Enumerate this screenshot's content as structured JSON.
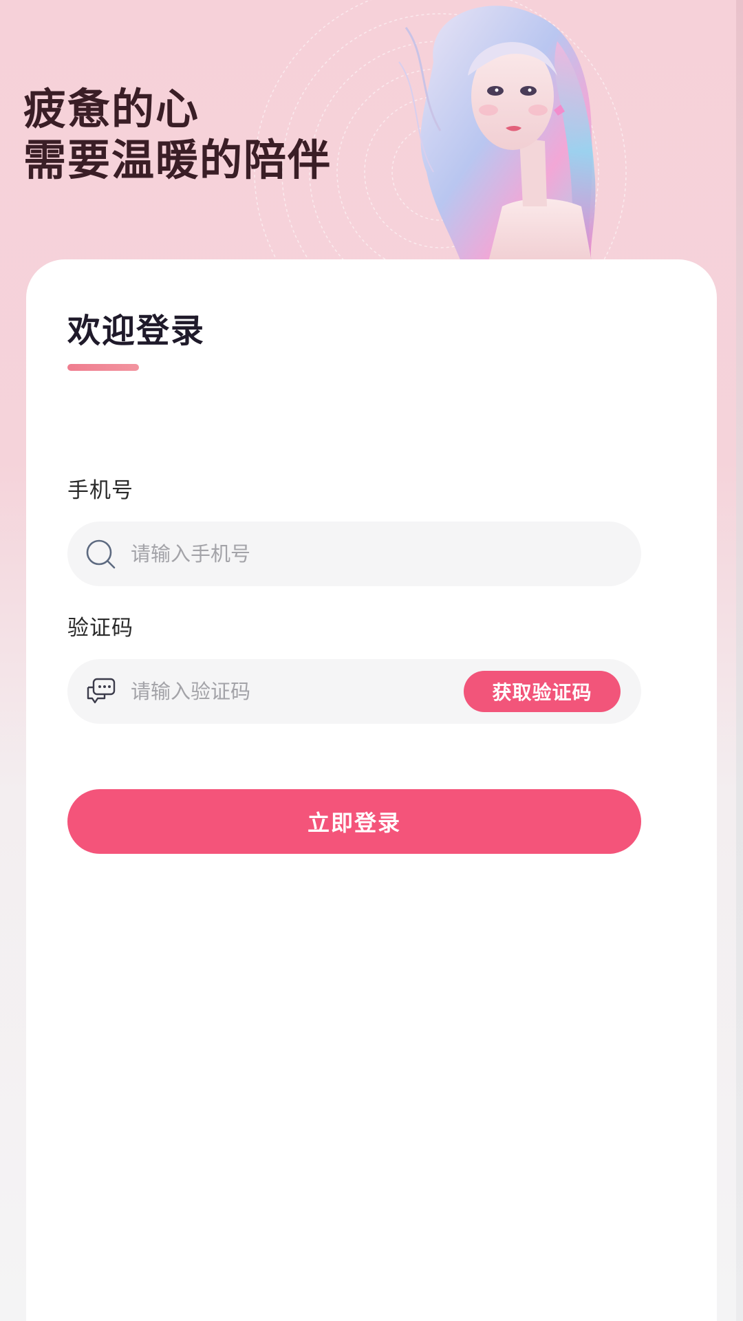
{
  "hero": {
    "line1": "疲惫的心",
    "line2": "需要温暖的陪伴"
  },
  "login_card": {
    "title": "欢迎登录",
    "phone": {
      "label": "手机号",
      "placeholder": "请输入手机号",
      "icon": "search-icon"
    },
    "code": {
      "label": "验证码",
      "placeholder": "请输入验证码",
      "icon": "chat-bubble-icon",
      "get_code_label": "获取验证码"
    },
    "submit_label": "立即登录"
  },
  "colors": {
    "accent": "#f4547a",
    "underline": "#ef7d8f",
    "hero_text": "#3a1e26",
    "background_top": "#f6d1d9"
  }
}
